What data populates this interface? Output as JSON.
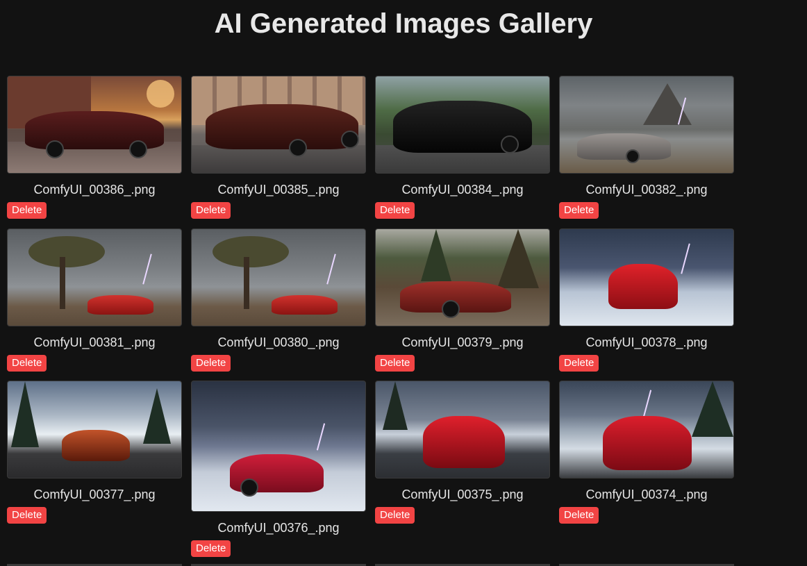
{
  "page": {
    "title": "AI Generated Images Gallery"
  },
  "gallery": {
    "delete_label": "Delete",
    "images": [
      {
        "filename": "ComfyUI_00386_.png",
        "scene": "maroon convertible in village street at sunset"
      },
      {
        "filename": "ComfyUI_00385_.png",
        "scene": "maroon convertible near arched building"
      },
      {
        "filename": "ComfyUI_00384_.png",
        "scene": "black convertible on mountain road"
      },
      {
        "filename": "ComfyUI_00382_.png",
        "scene": "grey convertible by lake with lightning"
      },
      {
        "filename": "ComfyUI_00381_.png",
        "scene": "red convertible under tree with storm"
      },
      {
        "filename": "ComfyUI_00380_.png",
        "scene": "red convertible under tree with storm"
      },
      {
        "filename": "ComfyUI_00379_.png",
        "scene": "red convertible in pine forest"
      },
      {
        "filename": "ComfyUI_00378_.png",
        "scene": "red car on snowy road with lightning"
      },
      {
        "filename": "ComfyUI_00377_.png",
        "scene": "orange sports car on snowy mountain road"
      },
      {
        "filename": "ComfyUI_00376_.png",
        "scene": "red convertible in snow with storm"
      },
      {
        "filename": "ComfyUI_00375_.png",
        "scene": "red car on wet snowy road"
      },
      {
        "filename": "ComfyUI_00374_.png",
        "scene": "red car on snowy lakeside road with lightning"
      }
    ]
  }
}
